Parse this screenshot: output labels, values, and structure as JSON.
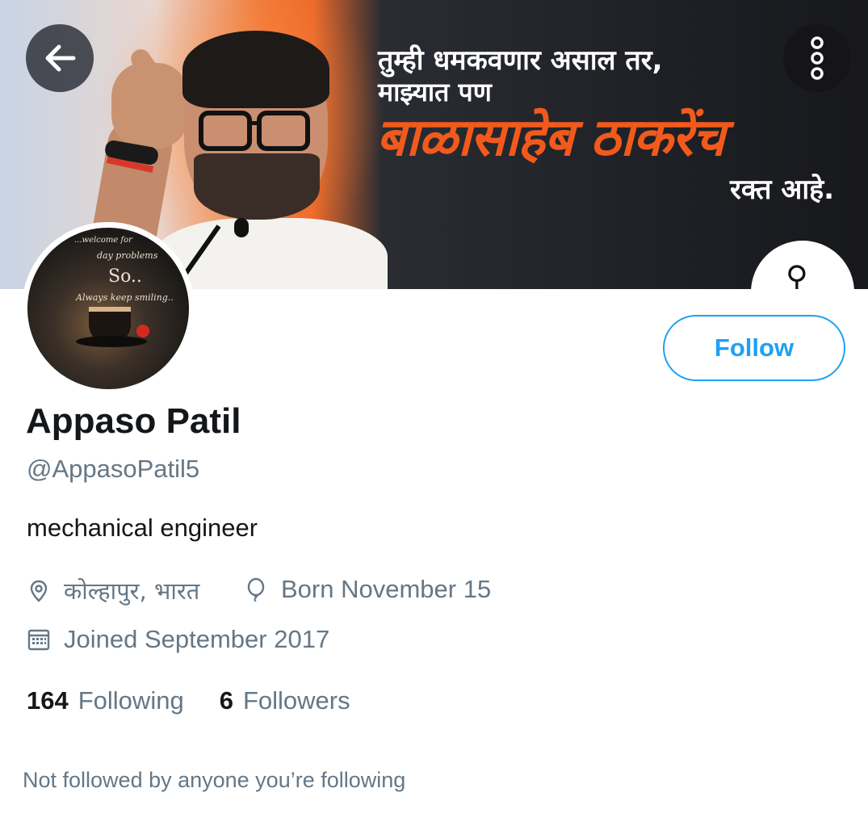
{
  "banner": {
    "line1": "तुम्ही धमकवणार असाल तर,",
    "line2": "माझ्यात पण",
    "big": "बाळासाहेब ठाकरेंच",
    "line3": "रक्त आहे."
  },
  "nav": {
    "back_icon": "arrow-left-icon",
    "more_icon": "more-vertical-icon"
  },
  "avatar": {
    "line1": "...welcome for",
    "line2": "day problems",
    "line3": "So..",
    "line4": "Always keep smiling.."
  },
  "profile": {
    "follow_label": "Follow",
    "name": "Appaso Patil",
    "handle": "@AppasoPatil5",
    "bio": "mechanical engineer",
    "location": "कोल्हापुर, भारत",
    "born": "Born November 15",
    "joined": "Joined September 2017"
  },
  "stats": {
    "following_count": "164",
    "following_label": "Following",
    "followers_count": "6",
    "followers_label": "Followers"
  },
  "footer": {
    "not_followed": "Not followed by anyone you’re following"
  },
  "colors": {
    "accent": "#1da1f2",
    "secondary_text": "#657786",
    "primary_text": "#14171a"
  }
}
